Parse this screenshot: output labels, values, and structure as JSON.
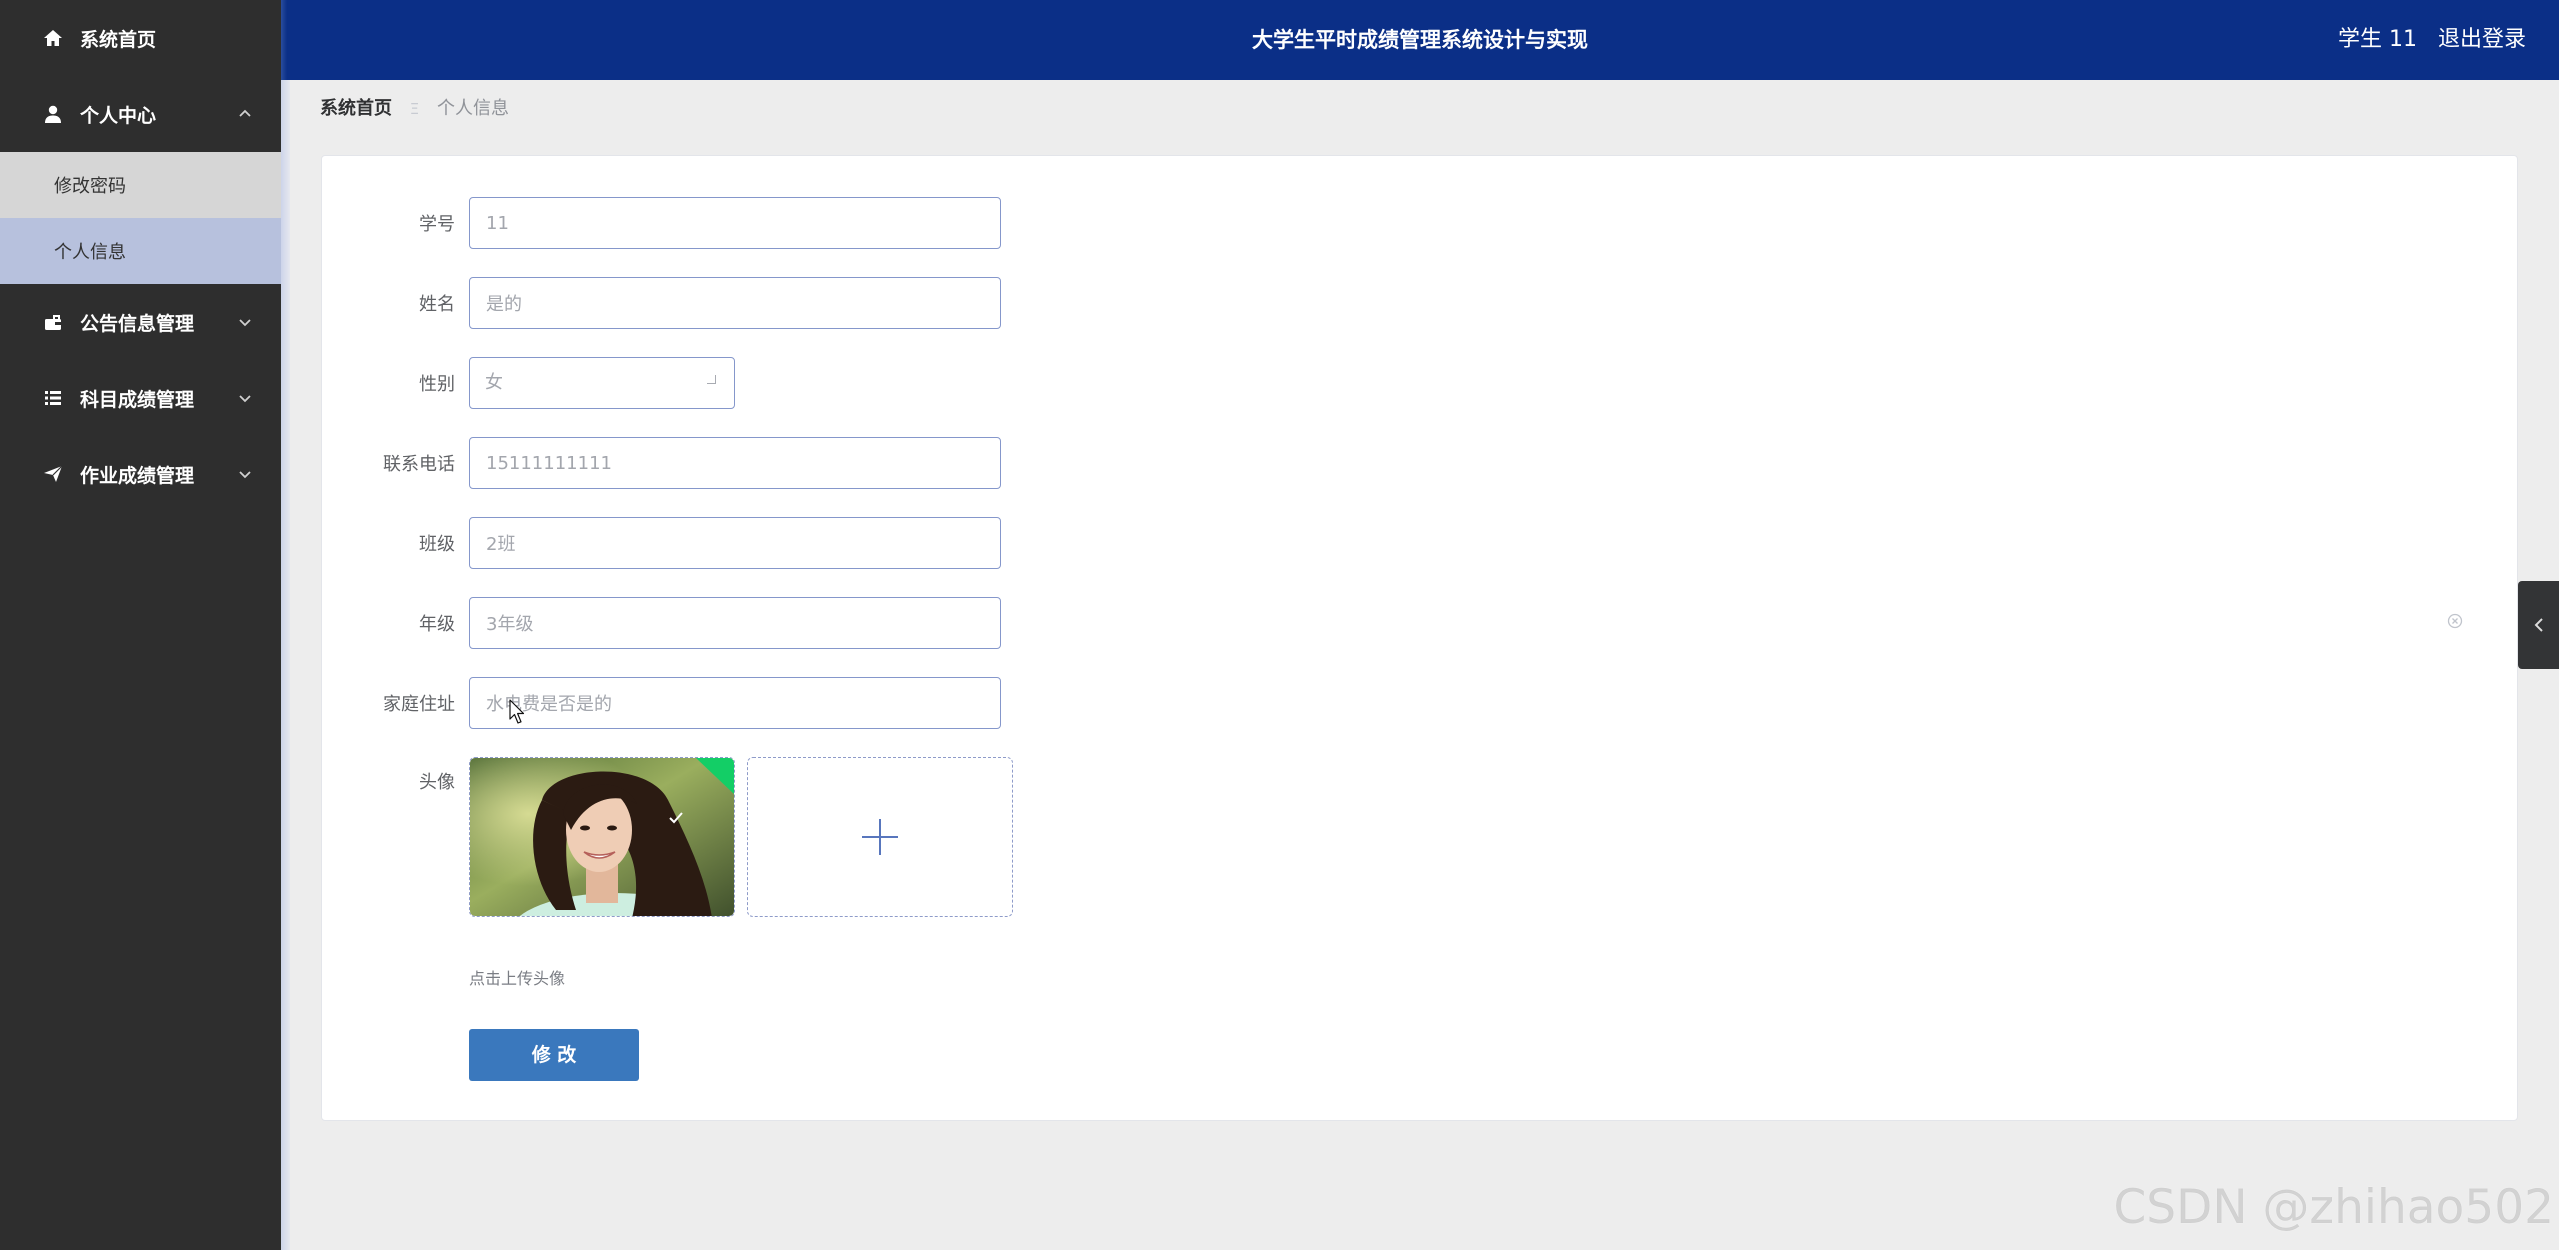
{
  "theme": {
    "sidebar_bg": "#2e2e2e",
    "header_bg": "#0b2f87",
    "main_bg": "#ededed",
    "submenu_bg": "#d6d6d6",
    "submenu_active_bg": "#b7c1dd",
    "input_border": "#8597cb",
    "button_bg": "#3a78bd",
    "success_green": "#13ce66",
    "upload_plus": "#5876bd"
  },
  "header": {
    "title": "大学生平时成绩管理系统设计与实现",
    "user_label": "学生 11",
    "logout_label": "退出登录"
  },
  "sidebar": {
    "items": [
      {
        "label": "系统首页",
        "icon": "home-icon"
      },
      {
        "label": "个人中心",
        "icon": "user-icon",
        "expanded": true,
        "children": [
          {
            "label": "修改密码",
            "active": false
          },
          {
            "label": "个人信息",
            "active": true
          }
        ]
      },
      {
        "label": "公告信息管理",
        "icon": "briefcase-icon",
        "expanded": false
      },
      {
        "label": "科目成绩管理",
        "icon": "list-icon",
        "expanded": false
      },
      {
        "label": "作业成绩管理",
        "icon": "paper-plane-icon",
        "expanded": false
      }
    ]
  },
  "breadcrumb": {
    "items": [
      "系统首页",
      "个人信息"
    ],
    "separator": "Ξ"
  },
  "form": {
    "fields": [
      {
        "label": "学号",
        "value": "11"
      },
      {
        "label": "姓名",
        "value": "是的"
      },
      {
        "label": "性别",
        "value": "女"
      },
      {
        "label": "联系电话",
        "value": "15111111111"
      },
      {
        "label": "班级",
        "value": "2班"
      },
      {
        "label": "年级",
        "value": "3年级"
      },
      {
        "label": "家庭住址",
        "value": "水电费是否是的"
      }
    ],
    "avatar": {
      "label": "头像",
      "uploaded": true,
      "hint": "点击上传头像"
    },
    "submit_label": "修 改"
  },
  "side_tab_icon": "chevron-left-icon",
  "watermark": "CSDN @zhihao502"
}
